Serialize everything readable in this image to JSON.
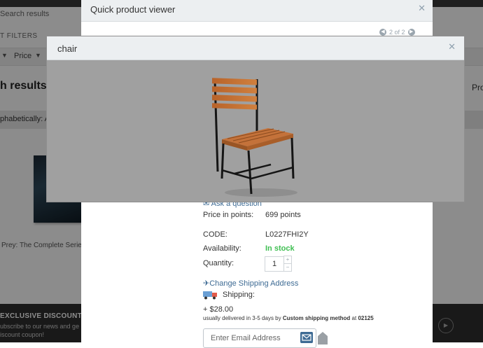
{
  "background": {
    "search_placeholder": "Search results",
    "filters_label": "T FILTERS",
    "sort_price_label": "Price",
    "results_heading": "h results",
    "right_partial": "Pro",
    "sort_row_text": "phabetically: A t",
    "product_title": "Prey: The Complete Series",
    "footer_title": "EXCLUSIVE DISCOUNTS",
    "footer_text": "ubscribe to our news and ge iscount coupon!"
  },
  "quick_viewer": {
    "title": "Quick product viewer",
    "pager": "2 of 2",
    "ask_question": "Ask a question",
    "price_label": "Price in points:",
    "price_value": "699 points",
    "code_label": "CODE:",
    "code_value": "L0227FHI2Y",
    "availability_label": "Availability:",
    "availability_value": "In stock",
    "quantity_label": "Quantity:",
    "quantity_value": "1",
    "change_shipping": "Change Shipping Address",
    "shipping_label": "Shipping:",
    "shipping_price": "+ $28.00",
    "shipping_note_pre": "usually delivered in 3-5 days by",
    "shipping_method": "Custom shipping method",
    "shipping_note_at": "at",
    "shipping_zip": "02125",
    "email_placeholder": "Enter Email Address"
  },
  "lightbox": {
    "title": "chair"
  }
}
